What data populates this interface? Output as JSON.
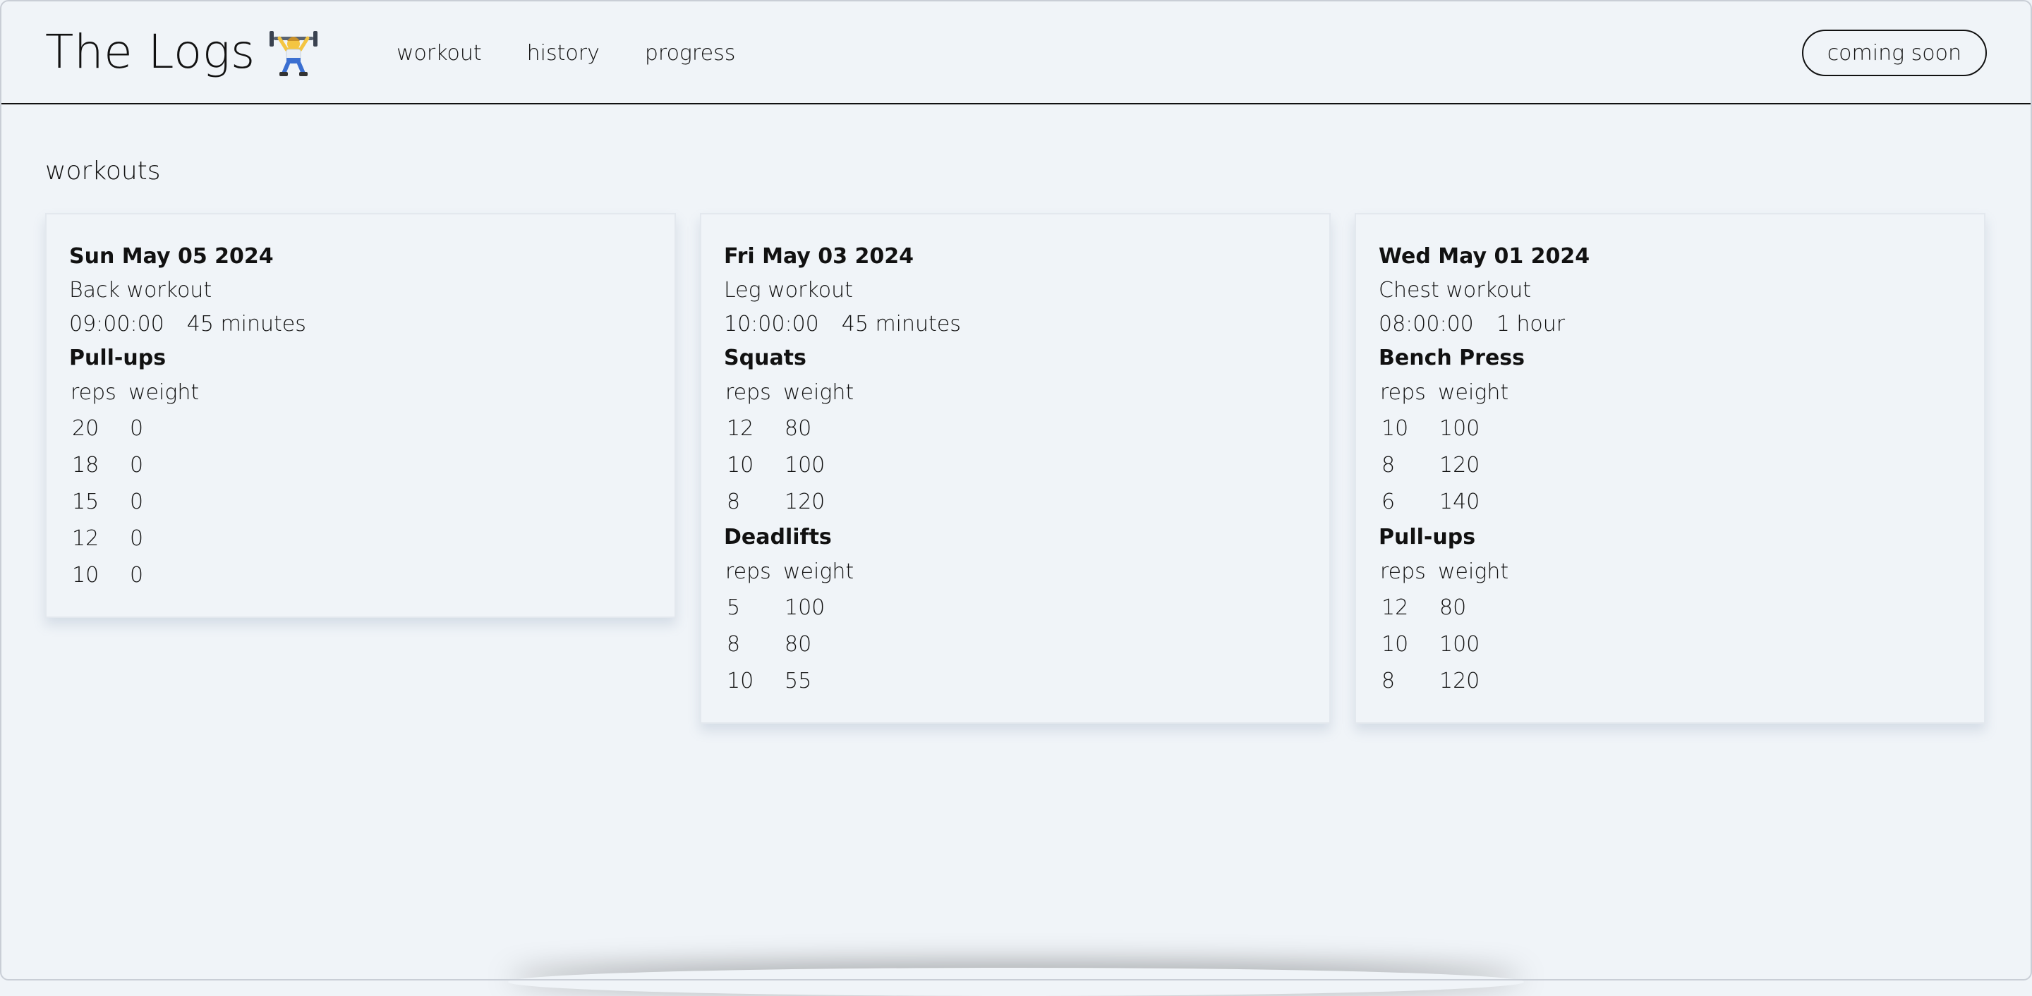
{
  "header": {
    "logo": "The Logs",
    "nav": [
      "workout",
      "history",
      "progress"
    ],
    "cta": "coming soon"
  },
  "main": {
    "section_title": "workouts",
    "columns": {
      "reps": "reps",
      "weight": "weight"
    },
    "cards": [
      {
        "date": "Sun May 05 2024",
        "name": "Back workout",
        "time": "09:00:00",
        "duration": "45 minutes",
        "exercises": [
          {
            "name": "Pull-ups",
            "sets": [
              {
                "reps": "20",
                "weight": "0"
              },
              {
                "reps": "18",
                "weight": "0"
              },
              {
                "reps": "15",
                "weight": "0"
              },
              {
                "reps": "12",
                "weight": "0"
              },
              {
                "reps": "10",
                "weight": "0"
              }
            ]
          }
        ]
      },
      {
        "date": "Fri May 03 2024",
        "name": "Leg workout",
        "time": "10:00:00",
        "duration": "45 minutes",
        "exercises": [
          {
            "name": "Squats",
            "sets": [
              {
                "reps": "12",
                "weight": "80"
              },
              {
                "reps": "10",
                "weight": "100"
              },
              {
                "reps": "8",
                "weight": "120"
              }
            ]
          },
          {
            "name": "Deadlifts",
            "sets": [
              {
                "reps": "5",
                "weight": "100"
              },
              {
                "reps": "8",
                "weight": "80"
              },
              {
                "reps": "10",
                "weight": "55"
              }
            ]
          }
        ]
      },
      {
        "date": "Wed May 01 2024",
        "name": "Chest workout",
        "time": "08:00:00",
        "duration": "1 hour",
        "exercises": [
          {
            "name": "Bench Press",
            "sets": [
              {
                "reps": "10",
                "weight": "100"
              },
              {
                "reps": "8",
                "weight": "120"
              },
              {
                "reps": "6",
                "weight": "140"
              }
            ]
          },
          {
            "name": "Pull-ups",
            "sets": [
              {
                "reps": "12",
                "weight": "80"
              },
              {
                "reps": "10",
                "weight": "100"
              },
              {
                "reps": "8",
                "weight": "120"
              }
            ]
          }
        ]
      }
    ]
  }
}
